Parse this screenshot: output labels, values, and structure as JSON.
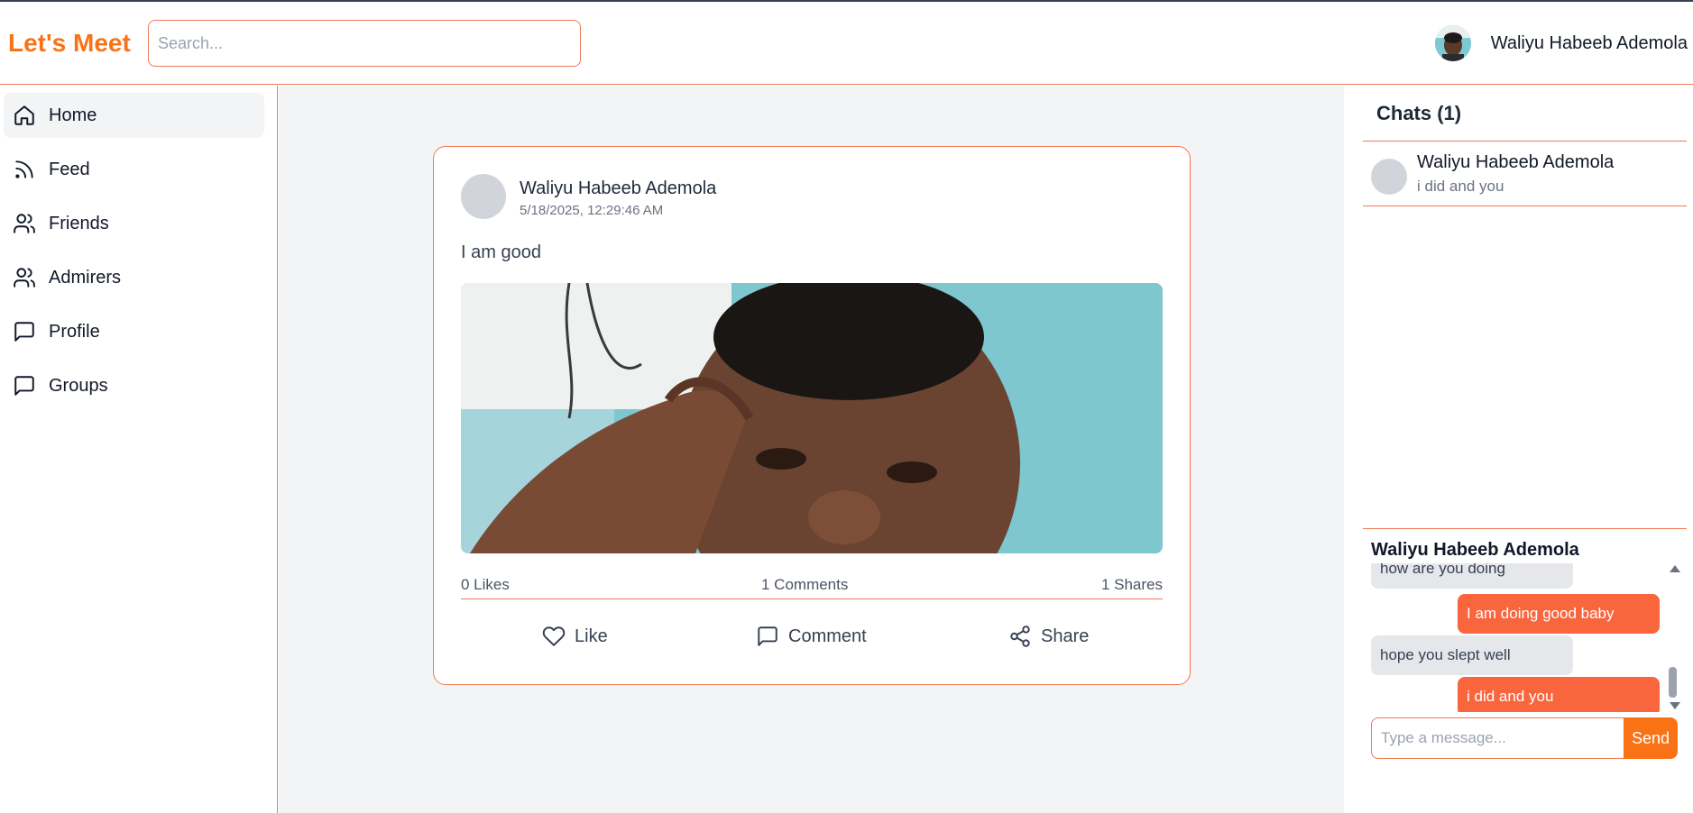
{
  "app": {
    "name": "Let's Meet",
    "brand_color": "#f97316",
    "accent_color": "#f9663e"
  },
  "header": {
    "search_placeholder": "Search...",
    "user_name": "Waliyu Habeeb Ademola"
  },
  "sidebar": {
    "items": [
      {
        "label": "Home",
        "icon": "home-icon",
        "active": true
      },
      {
        "label": "Feed",
        "icon": "rss-icon"
      },
      {
        "label": "Friends",
        "icon": "users-icon"
      },
      {
        "label": "Admirers",
        "icon": "users-icon"
      },
      {
        "label": "Profile",
        "icon": "message-square-icon"
      },
      {
        "label": "Groups",
        "icon": "message-square-icon"
      }
    ]
  },
  "post": {
    "author": "Waliyu Habeeb Ademola",
    "timestamp": "5/18/2025, 12:29:46 AM",
    "text": "I am good",
    "likes": "0 Likes",
    "comments": "1 Comments",
    "shares": "1 Shares",
    "actions": {
      "like": "Like",
      "comment": "Comment",
      "share": "Share"
    }
  },
  "chats": {
    "title": "Chats (1)",
    "items": [
      {
        "name": "Waliyu Habeeb Ademola",
        "last_message": "i did and you"
      }
    ]
  },
  "conversation": {
    "name": "Waliyu Habeeb Ademola",
    "messages": [
      {
        "text": "how are you doing",
        "direction": "in"
      },
      {
        "text": "I am doing good baby",
        "direction": "out"
      },
      {
        "text": "hope you slept well",
        "direction": "in"
      },
      {
        "text": "i did and you",
        "direction": "out"
      }
    ],
    "input_placeholder": "Type a message...",
    "send_label": "Send"
  }
}
